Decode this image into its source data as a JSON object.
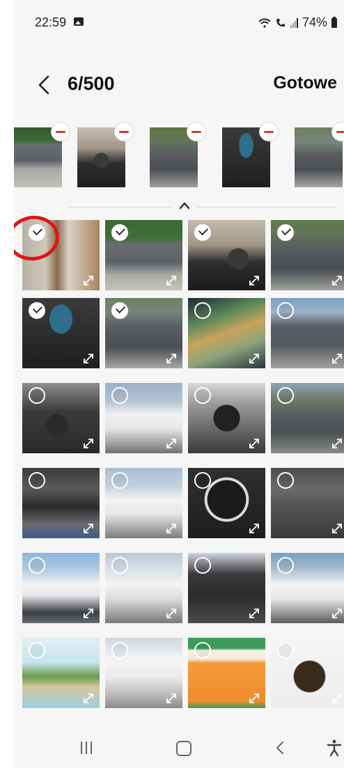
{
  "status_bar": {
    "time": "22:59",
    "battery": "74%",
    "icons": [
      "gallery-icon",
      "wifi-icon",
      "call-icon",
      "signal-icon",
      "battery-icon"
    ]
  },
  "header": {
    "counter": "6/500",
    "done_label": "Gotowe"
  },
  "strip": {
    "thumbs": [
      {
        "name": "strip-thumb-1",
        "bg": "linear-gradient(180deg,#355b2f 0%,#3f6a34 22%,#6c6f74 30%,#5d6166 55%,#a9a9a4 70%,#c3c1b8 100%)"
      },
      {
        "name": "strip-thumb-2",
        "bg": "radial-gradient(circle at 50% 55%,#3a3a3a 0 18%,transparent 19%),linear-gradient(180deg,#c8c0b2 0%,#9e9484 35%,#2d2d2d 60%,#1e1e1e 100%)"
      },
      {
        "name": "strip-thumb-3",
        "bg": "linear-gradient(180deg,#5e7a44 0%,#62735a 25%,#5a5d62 45%,#4c5055 70%,#9fa09a 100%)"
      },
      {
        "name": "strip-thumb-4",
        "bg": "radial-gradient(ellipse at 50% 30%,#2f6f8e 0 20%,transparent 22%),linear-gradient(180deg,#3b3b3b 0%,#2a2a2a 60%,#1f1f1f 100%)"
      },
      {
        "name": "strip-thumb-5",
        "bg": "linear-gradient(180deg,#6d8060 0%,#76857a 25%,#5b5e63 45%,#4c4f54 70%,#a7a8a2 100%)"
      }
    ]
  },
  "grid": {
    "tiles": [
      {
        "name": "photo-tile-1",
        "selected": true,
        "bg": "linear-gradient(90deg,#b7b2a6 0%,#cfc8b8 30%,#8a6a4f 45%,#d9d2c4 60%,#a8855d 100%)"
      },
      {
        "name": "photo-tile-2",
        "selected": true,
        "bg": "linear-gradient(180deg,#3c6a35 0%,#416f39 25%,#6a6e73 35%,#5d6166 60%,#a9a9a3 78%,#c5c3ba 100%)"
      },
      {
        "name": "photo-tile-3",
        "selected": true,
        "bg": "radial-gradient(circle at 65% 55%,#3a3a3a 0 16%,transparent 17%),linear-gradient(180deg,#c4bbae 0%,#a09684 35%,#2e2e2e 60%,#1c1c1c 100%)"
      },
      {
        "name": "photo-tile-4",
        "selected": true,
        "bg": "linear-gradient(180deg,#5d7a43 0%,#64745a 20%,#5a5d62 40%,#4a4e53 70%,#a2a39d 100%)"
      },
      {
        "name": "photo-tile-5",
        "selected": true,
        "bg": "radial-gradient(ellipse at 50% 30%,#2f6f8e 0 20%,transparent 22%),linear-gradient(180deg,#3b3b3b 0%,#2a2a2a 60%,#1f1f1f 100%)"
      },
      {
        "name": "photo-tile-6",
        "selected": true,
        "bg": "linear-gradient(180deg,#6c7f5f 0%,#76857a 20%,#5b5e63 40%,#4c4f54 70%,#a7a8a2 100%)"
      },
      {
        "name": "photo-tile-7",
        "selected": false,
        "bg": "linear-gradient(160deg,#1d2a33 0%,#5c8a5a 30%,#c9a25b 50%,#8aa27c 70%,#2a3640 100%)"
      },
      {
        "name": "photo-tile-8",
        "selected": false,
        "bg": "linear-gradient(180deg,#7c9ec2 0%,#9db3c7 20%,#5a5e62 40%,#55595e 65%,#9fa09b 100%)"
      },
      {
        "name": "photo-tile-9",
        "selected": false,
        "bg": "radial-gradient(circle at 45% 60%,#2a2a2a 0 18%,transparent 19%),linear-gradient(180deg,#8e8e8e 0%,#3b3b3b 40%,#2a2a2a 100%)"
      },
      {
        "name": "photo-tile-10",
        "selected": false,
        "bg": "linear-gradient(180deg,#9ab2c8 0%,#b3c2cf 25%,#f1f1f1 45%,#e5e6e7 65%,#707272 100%)"
      },
      {
        "name": "photo-tile-11",
        "selected": false,
        "bg": "radial-gradient(circle at 50% 50%,#222 0 25%,transparent 26%),linear-gradient(180deg,#d8d8d8 0%,#9a9a9a 30%,#3a3a3a 100%)"
      },
      {
        "name": "photo-tile-12",
        "selected": false,
        "bg": "linear-gradient(180deg,#8fa3b5 0%,#6d7a66 25%,#5a5d62 45%,#4c4f54 70%,#8b8c86 100%)"
      },
      {
        "name": "photo-tile-13",
        "selected": false,
        "bg": "linear-gradient(180deg,#3a3a3a 0%,#5a5a5a 30%,#2a2a2a 55%,#6a6b6e 80%,#3d5b8c 100%)"
      },
      {
        "name": "photo-tile-14",
        "selected": false,
        "bg": "linear-gradient(180deg,#a7bfd5 0%,#c2d0dc 25%,#f3f3f3 45%,#e7e8e9 65%,#7b7c7a 100%)"
      },
      {
        "name": "photo-tile-15",
        "selected": false,
        "bg": "radial-gradient(circle at 50% 45%,#1b1b1b 0 35%,#dcdcdc 36% 40%,transparent 41%),linear-gradient(180deg,#2f2f2f 0%,#1e1e1e 100%)"
      },
      {
        "name": "photo-tile-16",
        "selected": false,
        "bg": "linear-gradient(180deg,#4a4a4a 0%,#6b6b6b 30%,#555 55%,#3a3a3a 100%)"
      },
      {
        "name": "photo-tile-17",
        "selected": false,
        "bg": "linear-gradient(180deg,#8cb7dc 0%,#a6c6e0 20%,#f2f2f2 45%,#e6e7e8 60%,#3a3f45 85%,#6b6c6a 100%)"
      },
      {
        "name": "photo-tile-18",
        "selected": false,
        "bg": "linear-gradient(180deg,#b9c9d8 0%,#d4dde6 20%,#f4f4f4 45%,#dcdcdc 65%,#7a7a7a 100%)"
      },
      {
        "name": "photo-tile-19",
        "selected": false,
        "bg": "linear-gradient(180deg,#cfd6dd 0%,#3b3b3b 30%,#2a2a2a 60%,#4b4b4b 100%)"
      },
      {
        "name": "photo-tile-20",
        "selected": false,
        "bg": "linear-gradient(180deg,#7aa0c5 0%,#9fb7c9 20%,#f3f3f3 45%,#e7e8e9 65%,#5c5e5a 100%)"
      },
      {
        "name": "photo-tile-21",
        "selected": false,
        "bg": "linear-gradient(180deg,#dff0f5 0%,#c8e5ef 35%,#6a9a4a 55%,#d6c7a0 70%,#9ad0e0 100%)"
      },
      {
        "name": "photo-tile-22",
        "selected": false,
        "bg": "linear-gradient(180deg,#cfd6dd 0%,#f5f5f5 30%,#ececec 55%,#c8c8c8 75%,#8b8b8b 100%)"
      },
      {
        "name": "photo-tile-23",
        "selected": false,
        "bg": "linear-gradient(180deg,#3d9a5b 0%,#3d9a5b 15%,#f6f2e6 18%,#f0ead8 30%,#f59a3c 36%,#f08c2c 90%,#3d9a5b 100%)"
      },
      {
        "name": "photo-tile-24",
        "selected": false,
        "bg": "radial-gradient(ellipse at 50% 55%,#3a2a1a 0 28%,transparent 30%),linear-gradient(180deg,#f5f5f5 0%,#ededed 100%)"
      }
    ]
  },
  "navbar": {
    "buttons": [
      "recent-apps-button",
      "home-button",
      "back-button",
      "accessibility-button"
    ]
  }
}
